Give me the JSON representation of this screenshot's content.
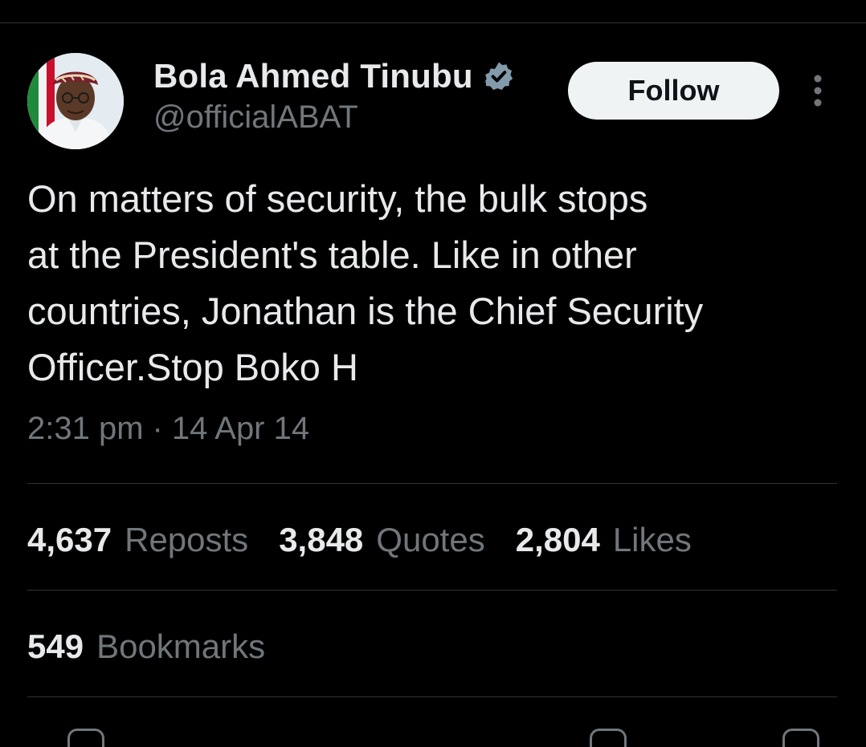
{
  "author": {
    "display_name": "Bola Ahmed Tinubu",
    "handle": "@officialABAT",
    "verified_icon": "verified-badge-icon",
    "verified_color": "#829aab"
  },
  "header": {
    "follow_label": "Follow",
    "more_icon": "more-vertical-icon"
  },
  "tweet": {
    "text": "On matters of security, the bulk stops\nat the President's table. Like in other\ncountries, Jonathan is the Chief Security\nOfficer.Stop Boko H",
    "time": "2:31 pm",
    "separator": "·",
    "date": "14 Apr 14"
  },
  "stats": {
    "reposts_count": "4,637",
    "reposts_label": "Reposts",
    "quotes_count": "3,848",
    "quotes_label": "Quotes",
    "likes_count": "2,804",
    "likes_label": "Likes",
    "bookmarks_count": "549",
    "bookmarks_label": "Bookmarks"
  },
  "colors": {
    "background": "#000000",
    "primary_text": "#e7e9ea",
    "secondary_text": "#71767b",
    "divider": "#2f3336",
    "follow_button_bg": "#eff3f4",
    "follow_button_text": "#0f1419"
  }
}
